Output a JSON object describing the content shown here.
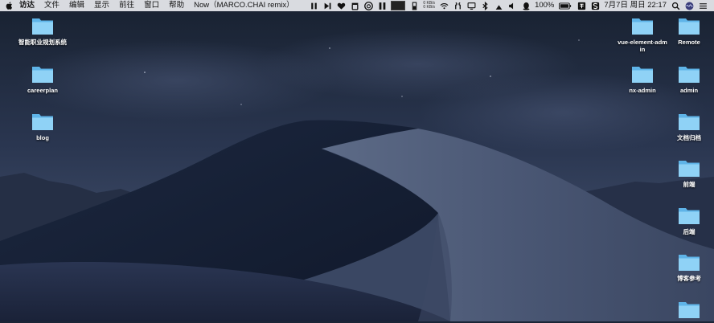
{
  "menubar": {
    "app_name": "访达",
    "menus": [
      "文件",
      "编辑",
      "显示",
      "前往",
      "窗口",
      "帮助"
    ],
    "now_playing": "Now（MARCO.CHAI remix）",
    "net_up": "0 KB/s",
    "net_down": "0 KB/s",
    "battery_percent": "100%",
    "datetime": "7月7日 周日 22:17"
  },
  "desktop_left": [
    {
      "label": "智能职业规划系统"
    },
    {
      "label": "careerplan"
    },
    {
      "label": "blog"
    }
  ],
  "desktop_right": [
    {
      "label": "vue-element-admin"
    },
    {
      "label": "Remote"
    },
    {
      "label": "nx-admin"
    },
    {
      "label": "admin"
    },
    {
      "label": "文档归档"
    },
    {
      "label": "前端"
    },
    {
      "label": "后端"
    },
    {
      "label": "博客参考"
    },
    {
      "label": ""
    }
  ],
  "colors": {
    "folder_light": "#8fd2f6",
    "folder_dark": "#5fb4e8",
    "sky_top": "#1a2334",
    "dune": "#3a4660"
  }
}
